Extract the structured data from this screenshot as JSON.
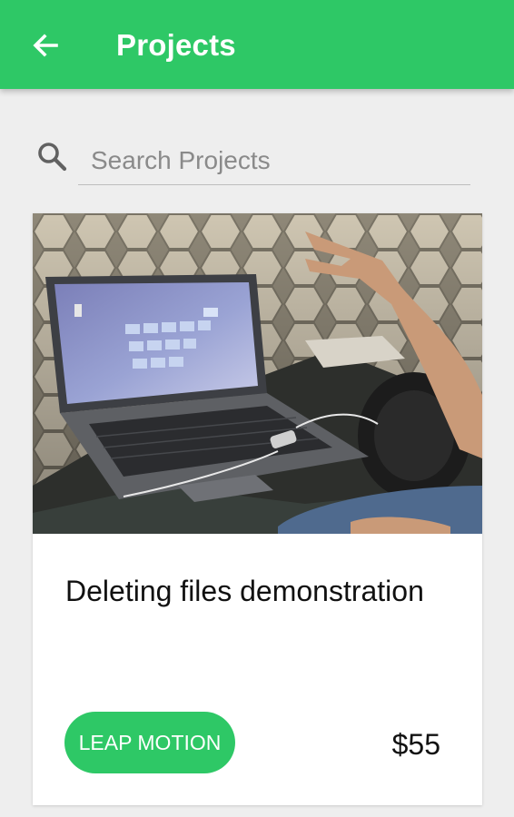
{
  "appbar": {
    "title": "Projects",
    "back_icon": "arrow-left-icon",
    "color": "#2ec866"
  },
  "search": {
    "placeholder": "Search Projects",
    "value": "",
    "icon": "search-icon"
  },
  "projects": [
    {
      "title": "Deleting files demonstration",
      "tag": "LEAP MOTION",
      "price": "$55",
      "image": "photo of a laptop showing a tile grid with a hand gesturing above a small sensor"
    }
  ],
  "colors": {
    "accent": "#2ec866",
    "background": "#eeeeee",
    "card": "#ffffff"
  }
}
